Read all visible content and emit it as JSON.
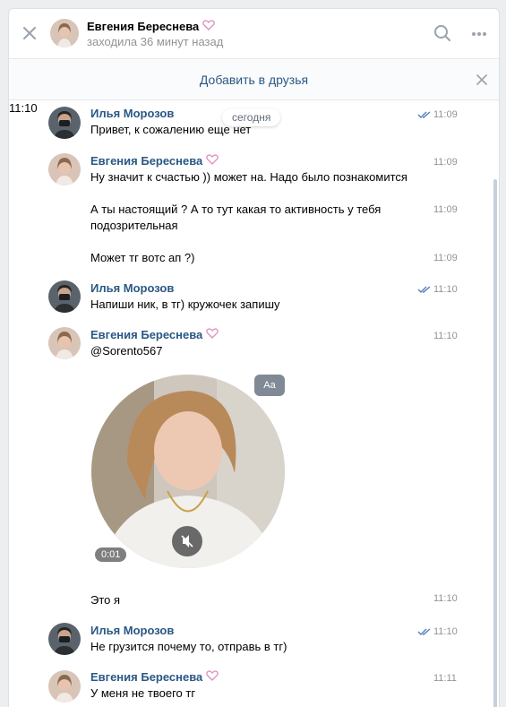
{
  "header": {
    "name": "Евгения Береснева",
    "status": "заходила 36 минут назад"
  },
  "add_friend": {
    "label": "Добавить в друзья"
  },
  "date_pill": "сегодня",
  "messages": [
    {
      "author": "Илья Морозов",
      "text": "Привет, к сожалению еще нет",
      "time": "11:09"
    },
    {
      "author": "Евгения Береснева",
      "text": "Ну значит к счастью )) может на. Надо было познакомится",
      "time": "11:09"
    },
    {
      "text": "А ты настоящий ? А то тут какая то активность у тебя подозрительная",
      "time": "11:09"
    },
    {
      "text": "Может тг вотс ап ?)",
      "time": "11:09"
    },
    {
      "author": "Илья Морозов",
      "text": "Напиши ник, в тг) кружочек запишу",
      "time": "11:10"
    },
    {
      "author": "Евгения Береснева",
      "text": "@Sorento567",
      "time": "11:10"
    },
    {
      "time": "11:10",
      "video_duration": "0:01",
      "aa_label": "Aa"
    },
    {
      "text": "Это я",
      "time": "11:10"
    },
    {
      "author": "Илья Морозов",
      "text": "Не грузится почему то, отправь в тг)",
      "time": "11:10"
    },
    {
      "author": "Евгения Береснева",
      "text": "У меня не твоего тг",
      "time": "11:11"
    }
  ],
  "colors": {
    "link": "#2a5885",
    "muted": "#939393",
    "read_check": "#5181b8",
    "heart": "#e08bbd"
  },
  "icons": [
    "close-icon",
    "search-icon",
    "more-icon",
    "heart-icon",
    "read-check-icon",
    "mute-icon"
  ]
}
